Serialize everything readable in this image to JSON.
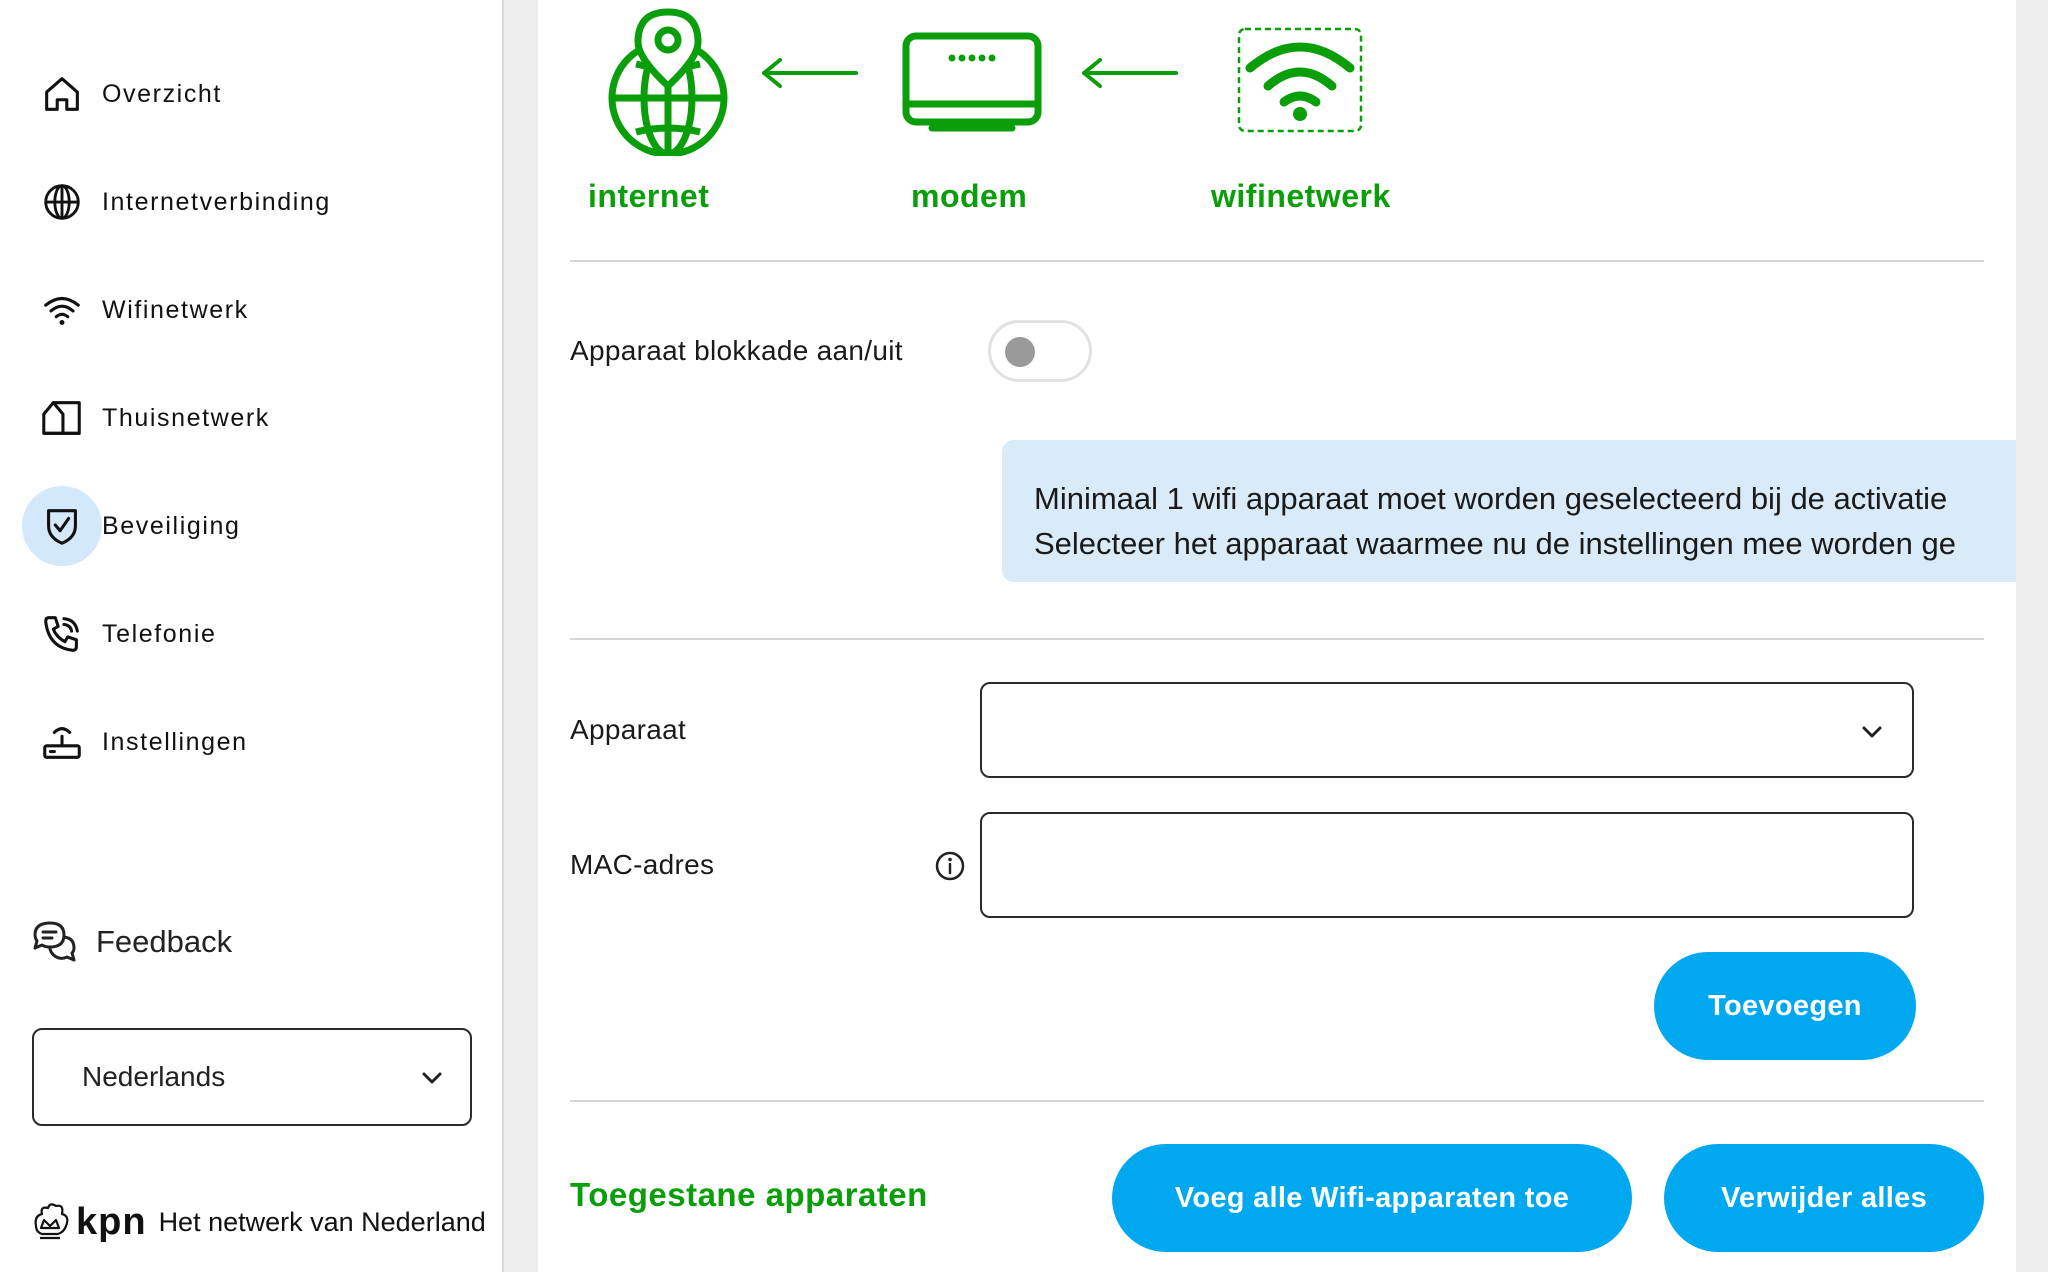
{
  "sidebar": {
    "items": [
      {
        "label": "Overzicht",
        "icon": "home-icon"
      },
      {
        "label": "Internetverbinding",
        "icon": "globe-icon"
      },
      {
        "label": "Wifinetwerk",
        "icon": "wifi-icon"
      },
      {
        "label": "Thuisnetwerk",
        "icon": "house-network-icon"
      },
      {
        "label": "Beveiliging",
        "icon": "shield-check-icon",
        "active": true
      },
      {
        "label": "Telefonie",
        "icon": "phone-icon"
      },
      {
        "label": "Instellingen",
        "icon": "router-icon"
      }
    ],
    "feedback": "Feedback",
    "language": "Nederlands",
    "brand": {
      "name": "kpn",
      "tagline": "Het netwerk van Nederland"
    }
  },
  "diagram": {
    "internet": "internet",
    "modem": "modem",
    "wifi": "wifinetwerk",
    "accent": "#0a9e0a"
  },
  "block": {
    "label": "Apparaat blokkade aan/uit",
    "enabled": false
  },
  "info": {
    "line1": "Minimaal 1 wifi apparaat moet worden geselecteerd bij de activatie",
    "line2": "Selecteer het apparaat waarmee nu de instellingen mee worden ge"
  },
  "form": {
    "device_label": "Apparaat",
    "device_value": "",
    "mac_label": "MAC-adres",
    "mac_value": "",
    "add_button": "Toevoegen"
  },
  "allowed": {
    "title": "Toegestane apparaten",
    "add_all_button": "Voeg alle Wifi-apparaten toe",
    "remove_all_button": "Verwijder alles"
  },
  "colors": {
    "accent_blue": "#00a8f0",
    "accent_green": "#0a9e0a",
    "info_bg": "#d9eaf8",
    "active_nav_bg": "#d3e8fb"
  }
}
